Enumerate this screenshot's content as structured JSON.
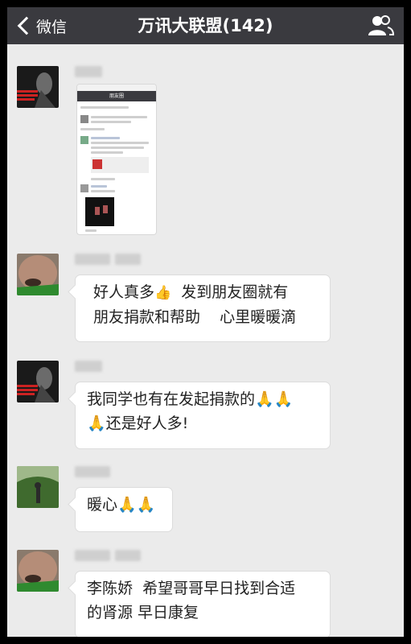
{
  "navbar": {
    "back_label": "微信",
    "title": "万讯大联盟(142)",
    "contacts_icon": "contacts-icon"
  },
  "thumbnail": {
    "nav_title": "朋友圈"
  },
  "messages": [
    {
      "type": "image"
    },
    {
      "type": "text",
      "text": "好人真多",
      "emoji_after": "👍",
      "text_tail": "  发到朋友圈就有\n朋友捐款和帮助    心里暖暖滴"
    },
    {
      "type": "text",
      "text": "我同学也有在发起捐款的🙏🙏\n🙏还是好人多!"
    },
    {
      "type": "text",
      "text": "暖心🙏🙏"
    },
    {
      "type": "text",
      "text": "李陈娇  希望哥哥早日找到合适\n的肾源 早日康复"
    }
  ]
}
